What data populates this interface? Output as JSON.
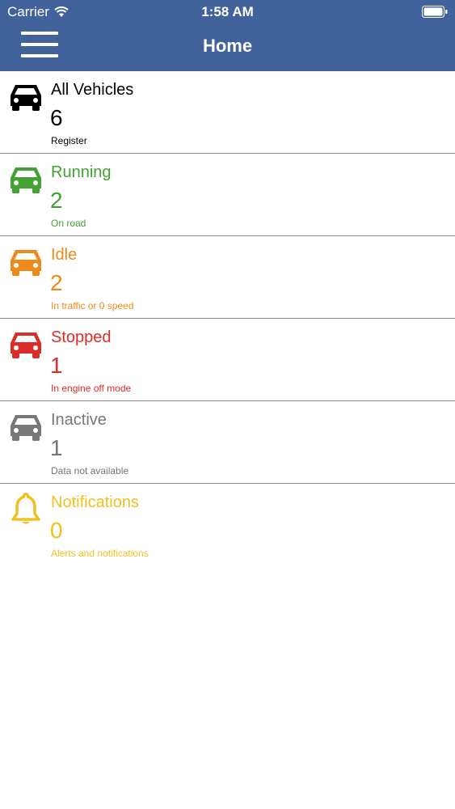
{
  "status_bar": {
    "carrier": "Carrier",
    "time": "1:58 AM"
  },
  "navbar": {
    "title": "Home",
    "menu_icon": "hamburger-menu-icon"
  },
  "colors": {
    "header": "#42629b",
    "all": "#000000",
    "running": "#43a032",
    "idle": "#ee8a1b",
    "stopped": "#dd2d2a",
    "inactive": "#777777",
    "notifications": "#f0c022"
  },
  "rows": [
    {
      "title": "All Vehicles",
      "count": "6",
      "sub": "Register",
      "icon": "car-icon"
    },
    {
      "title": "Running",
      "count": "2",
      "sub": "On road",
      "icon": "car-icon"
    },
    {
      "title": "Idle",
      "count": "2",
      "sub": "In traffic or 0 speed",
      "icon": "car-icon"
    },
    {
      "title": "Stopped",
      "count": "1",
      "sub": "In engine off mode",
      "icon": "car-icon"
    },
    {
      "title": "Inactive",
      "count": "1",
      "sub": "Data not available",
      "icon": "car-icon"
    },
    {
      "title": "Notifications",
      "count": "0",
      "sub": "Alerts and notifications",
      "icon": "bell-icon"
    }
  ]
}
